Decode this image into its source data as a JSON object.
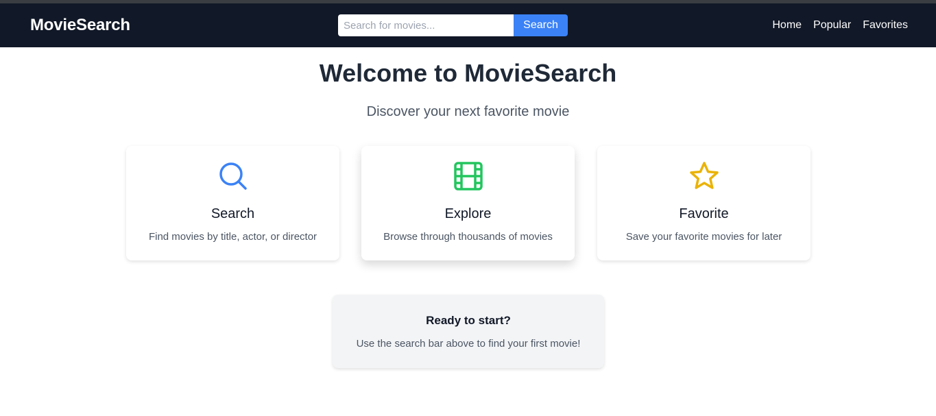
{
  "navbar": {
    "brand": "MovieSearch",
    "search": {
      "placeholder": "Search for movies...",
      "value": "",
      "button_label": "Search"
    },
    "links": [
      "Home",
      "Popular",
      "Favorites"
    ]
  },
  "hero": {
    "title": "Welcome to MovieSearch",
    "subtitle": "Discover your next favorite movie"
  },
  "features": [
    {
      "icon": "search-icon",
      "title": "Search",
      "description": "Find movies by title, actor, or director",
      "color": "#3b82f6"
    },
    {
      "icon": "film-icon",
      "title": "Explore",
      "description": "Browse through thousands of movies",
      "color": "#22c55e"
    },
    {
      "icon": "star-icon",
      "title": "Favorite",
      "description": "Save your favorite movies for later",
      "color": "#eab308"
    }
  ],
  "cta": {
    "title": "Ready to start?",
    "description": "Use the search bar above to find your first movie!"
  },
  "colors": {
    "navbar_bg": "#111827",
    "accent": "#3b82f6"
  }
}
